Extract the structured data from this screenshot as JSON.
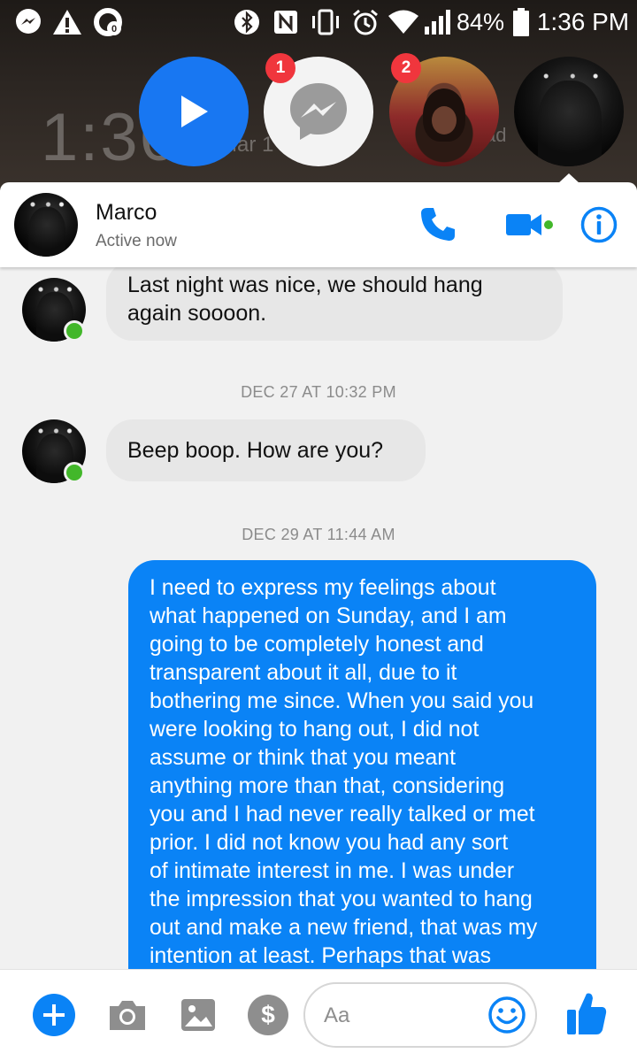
{
  "status_bar": {
    "battery": "84%",
    "time": "1:36 PM",
    "icons": [
      "messenger-icon",
      "warning-icon",
      "data-saver-icon",
      "bluetooth-icon",
      "nfc-icon",
      "vibrate-icon",
      "alarm-icon",
      "wifi-icon",
      "signal-icon",
      "battery-icon"
    ]
  },
  "lockscreen": {
    "time": "1:36",
    "date": "Mar 1",
    "right_text": "ad"
  },
  "chat_heads": [
    {
      "name": "video-play-head",
      "badge": ""
    },
    {
      "name": "messenger-head",
      "badge": "1"
    },
    {
      "name": "contact-head-2",
      "badge": "2"
    },
    {
      "name": "marco-head",
      "badge": ""
    }
  ],
  "header": {
    "contact_name": "Marco",
    "status": "Active now",
    "accent_color": "#0a83f6",
    "online_color": "#42b72a"
  },
  "messages": [
    {
      "type": "incoming",
      "text_lines": [
        "Last night was nice, we should hang",
        "again soooon."
      ]
    },
    {
      "type": "timestamp",
      "text": "DEC 27 AT 10:32 PM"
    },
    {
      "type": "incoming",
      "text_lines": [
        "Beep boop. How are you?"
      ]
    },
    {
      "type": "timestamp",
      "text": "DEC 29 AT 11:44 AM"
    },
    {
      "type": "outgoing",
      "text_lines": [
        "I need to express my feelings about",
        "what happened on Sunday, and I am",
        "going to be completely honest and",
        "transparent about it all, due to it",
        "bothering me since. When you said you",
        "were looking to hang out, I did not",
        "assume or think that you meant",
        "anything more than that, considering",
        "you and I had never really talked or met",
        "prior. I did not know you had any sort",
        "of intimate interest in me. I was under",
        "the impression that you wanted to hang",
        "out and make a new friend, that was my",
        "intention at least. Perhaps that was"
      ]
    }
  ],
  "composer": {
    "placeholder": "Aa",
    "icons": [
      "add-icon",
      "camera-icon",
      "gallery-icon",
      "payment-icon",
      "emoji-icon",
      "like-icon"
    ]
  }
}
